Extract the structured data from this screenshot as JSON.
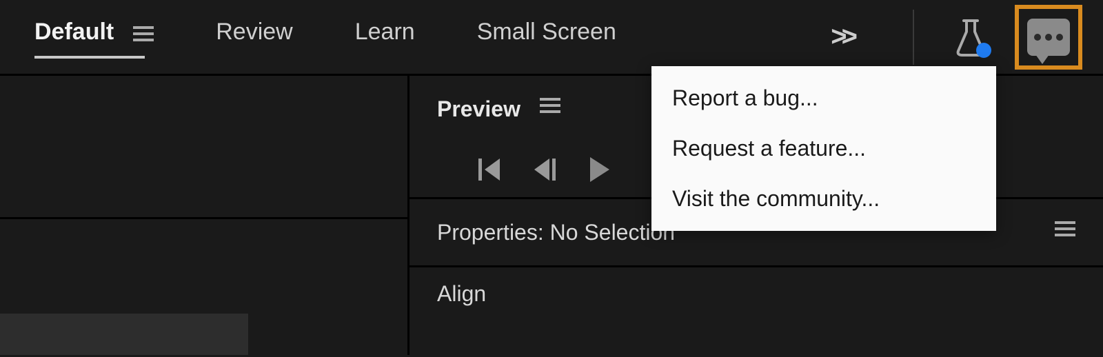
{
  "workspaces": {
    "items": [
      {
        "label": "Default",
        "active": true,
        "has_menu": true
      },
      {
        "label": "Review",
        "active": false,
        "has_menu": false
      },
      {
        "label": "Learn",
        "active": false,
        "has_menu": false
      },
      {
        "label": "Small Screen",
        "active": false,
        "has_menu": false
      }
    ]
  },
  "topbar": {
    "more_glyph": ">>"
  },
  "panels": {
    "preview": {
      "title": "Preview"
    },
    "properties": {
      "title": "Properties: No Selection"
    },
    "align": {
      "title": "Align"
    }
  },
  "feedback_menu": {
    "items": [
      {
        "label": "Report a bug..."
      },
      {
        "label": "Request a feature..."
      },
      {
        "label": "Visit the community..."
      }
    ]
  }
}
